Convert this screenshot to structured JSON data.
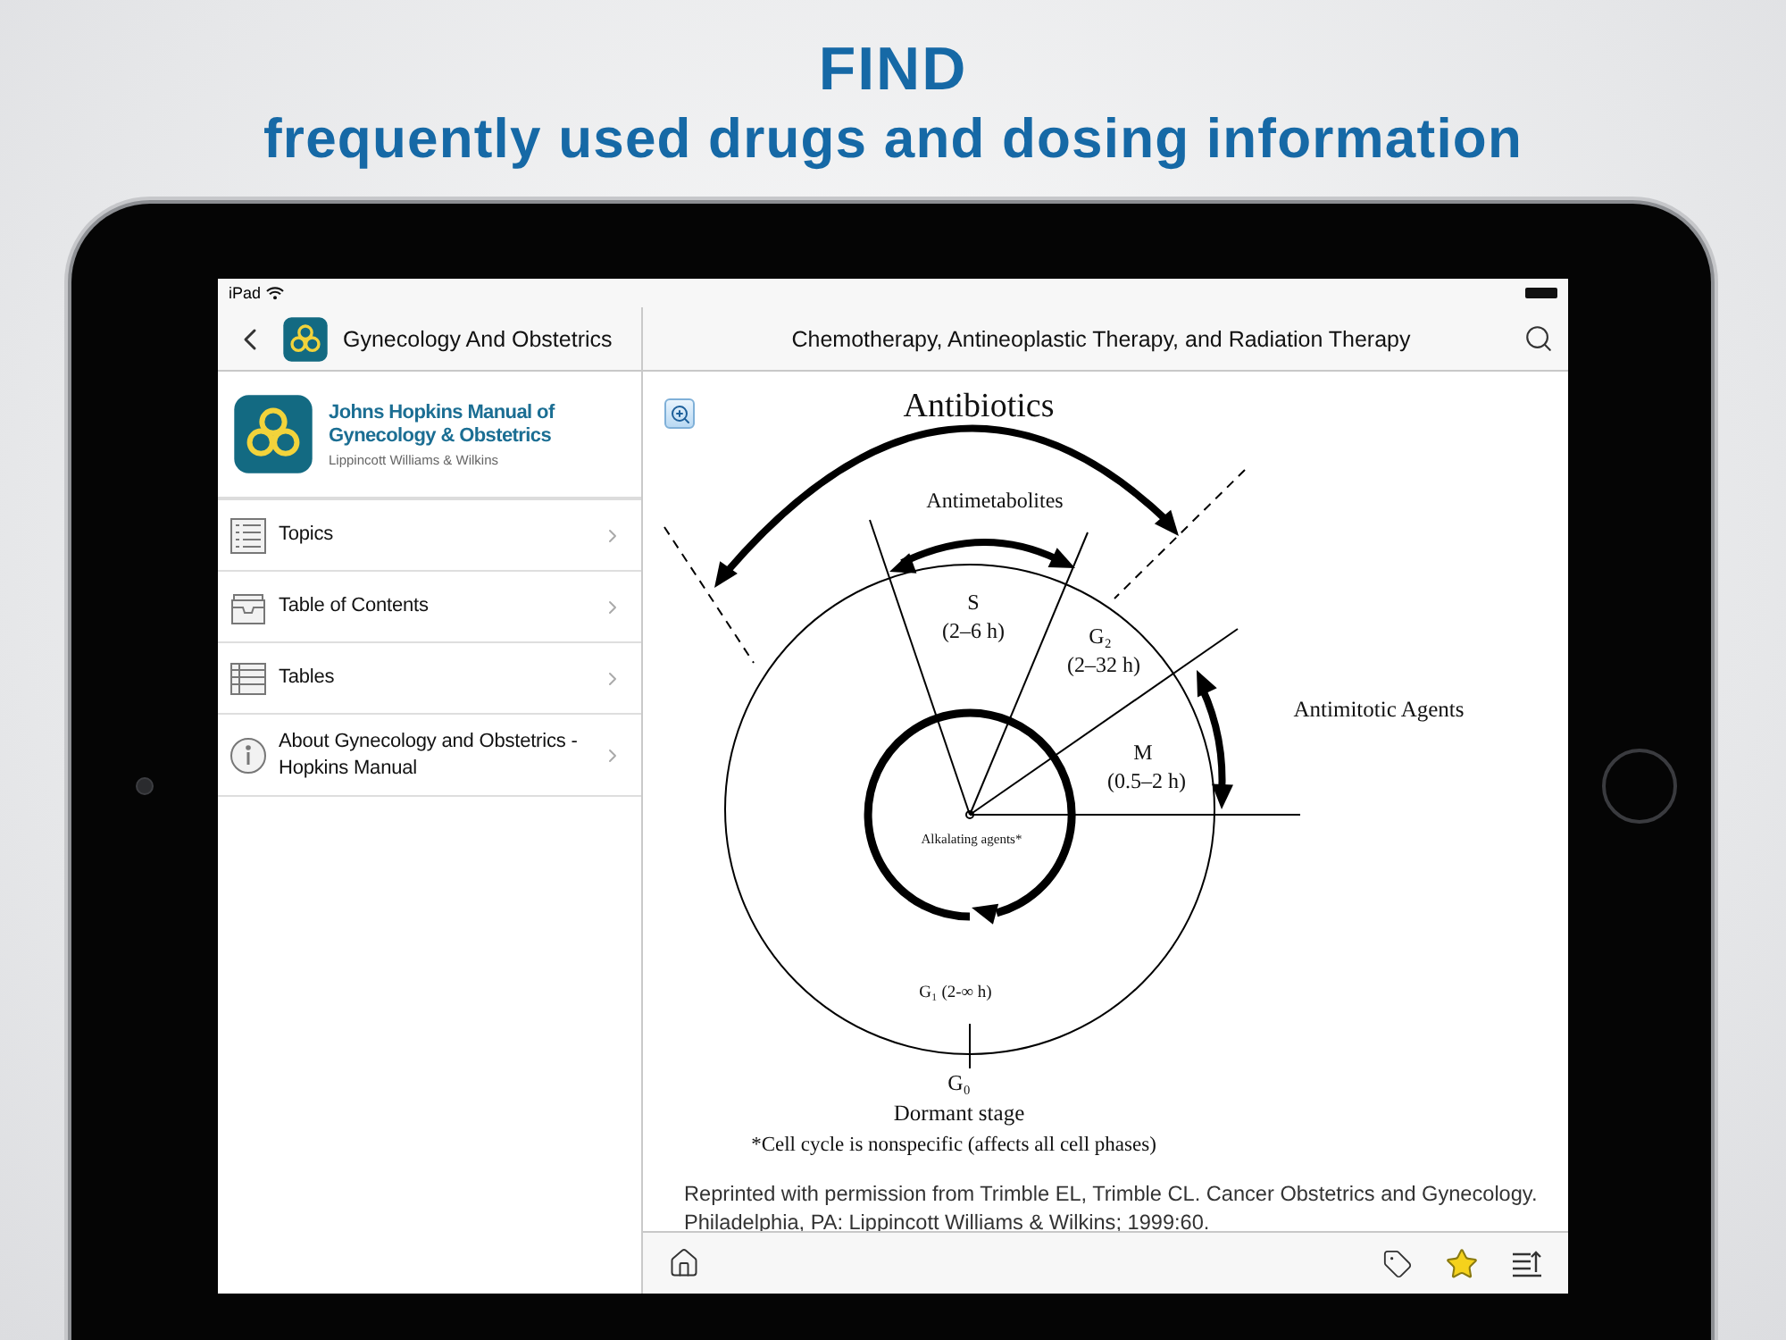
{
  "headline": {
    "title": "FIND",
    "subtitle": "frequently used drugs and dosing information"
  },
  "status_bar": {
    "carrier": "iPad"
  },
  "sidebar": {
    "nav_title": "Gynecology And Obstetrics",
    "book": {
      "title": "Johns Hopkins Manual of Gynecology & Obstetrics",
      "publisher": "Lippincott Williams & Wilkins"
    },
    "items": [
      {
        "label": "Topics",
        "kind": "topics"
      },
      {
        "label": "Table of Contents",
        "kind": "contents"
      },
      {
        "label": "Tables",
        "kind": "tables"
      },
      {
        "label": "About Gynecology and Obstetrics - Hopkins Manual",
        "kind": "about"
      }
    ]
  },
  "content": {
    "nav_title": "Chemotherapy, Antineoplastic Therapy, and Radiation Therapy",
    "figure": {
      "labels": [
        "Antibiotics",
        "Antimetabolites",
        "S",
        "(2–6 h)",
        "G₂",
        "(2–32 h)",
        "Antimitotic Agents",
        "M",
        "(0.5–2 h)",
        "Alkalating agents*",
        "G₁ (2-∞ h)",
        "G₀",
        "Dormant stage",
        "*Cell cycle is nonspecific (affects all cell phases)"
      ]
    },
    "credit": "Reprinted with permission from Trimble EL, Trimble CL. Cancer Obstetrics and Gynecology. Philadelphia, PA: Lippincott Williams & Wilkins; 1999:60."
  },
  "toolbar": {
    "favorite": true
  }
}
